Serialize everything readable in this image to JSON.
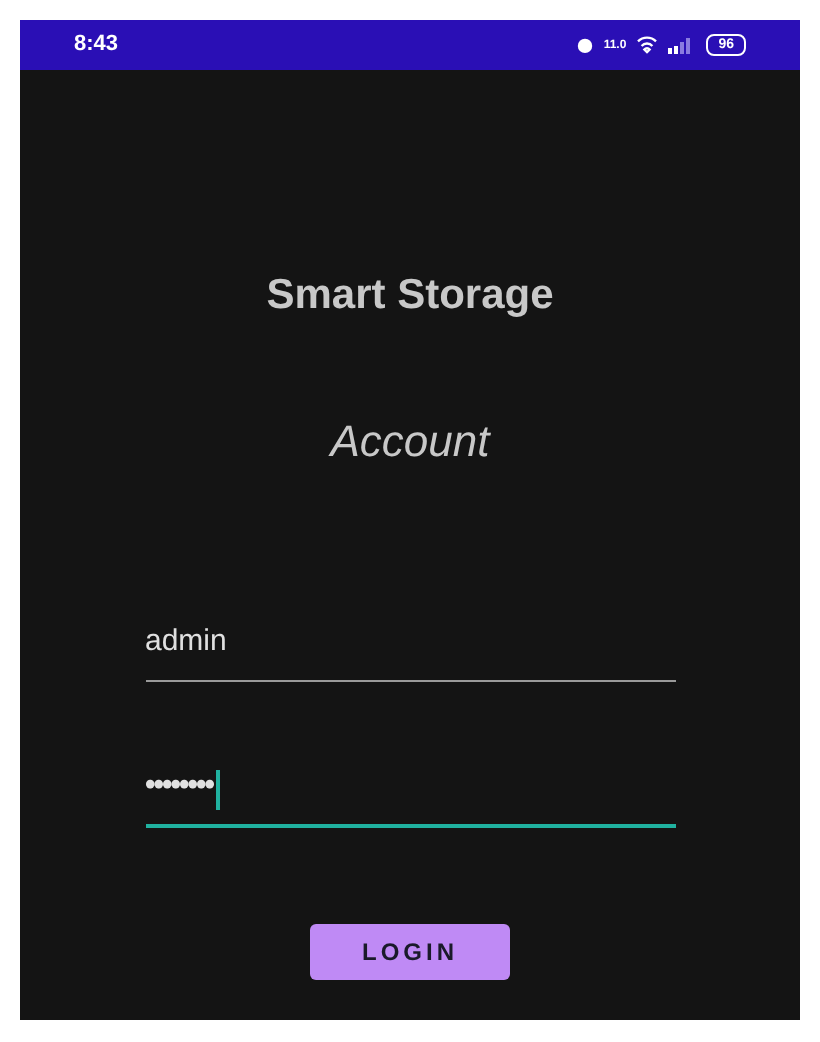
{
  "status_bar": {
    "time": "8:43",
    "net_speed": "11.0",
    "battery": "96"
  },
  "title": "Smart Storage",
  "subtitle": "Account",
  "fields": [
    {
      "kind": "text",
      "value": "admin",
      "focused": false
    },
    {
      "kind": "password",
      "value": "••••••••",
      "focused": true
    }
  ],
  "button": "LOGIN"
}
